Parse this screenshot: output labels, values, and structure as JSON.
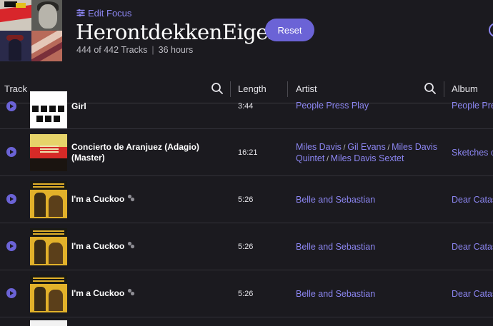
{
  "header": {
    "edit_focus_label": "Edit Focus",
    "playlist_title": "HerontdekkenEigen",
    "track_count": "444 of 442 Tracks",
    "separator": "|",
    "duration": "36 hours",
    "reset_label": "Reset"
  },
  "columns": {
    "track": "Track",
    "length": "Length",
    "artist": "Artist",
    "album": "Album"
  },
  "rows": [
    {
      "track": "Girl",
      "length": "3:44",
      "artists": [
        "People Press Play"
      ],
      "album": "People Pre",
      "art": "bw"
    },
    {
      "track": "Concierto de Aranjuez (Adagio) (Master)",
      "length": "16:21",
      "artists": [
        "Miles Davis",
        "Gil Evans",
        "Miles Davis Quintet",
        "Miles Davis Sextet"
      ],
      "album": "Sketches o",
      "art": "red"
    },
    {
      "track": "I'm a Cuckoo",
      "length": "5:26",
      "artists": [
        "Belle and Sebastian"
      ],
      "album": "Dear Catas",
      "art": "yellow",
      "has_tag_icon": true
    },
    {
      "track": "I'm a Cuckoo",
      "length": "5:26",
      "artists": [
        "Belle and Sebastian"
      ],
      "album": "Dear Catas",
      "art": "yellow",
      "has_tag_icon": true
    },
    {
      "track": "I'm a Cuckoo",
      "length": "5:26",
      "artists": [
        "Belle and Sebastian"
      ],
      "album": "Dear Catas",
      "art": "yellow",
      "has_tag_icon": true
    }
  ],
  "colors": {
    "accent": "#6b63d6",
    "link": "#8c86f2",
    "background": "#1b1a1f"
  }
}
